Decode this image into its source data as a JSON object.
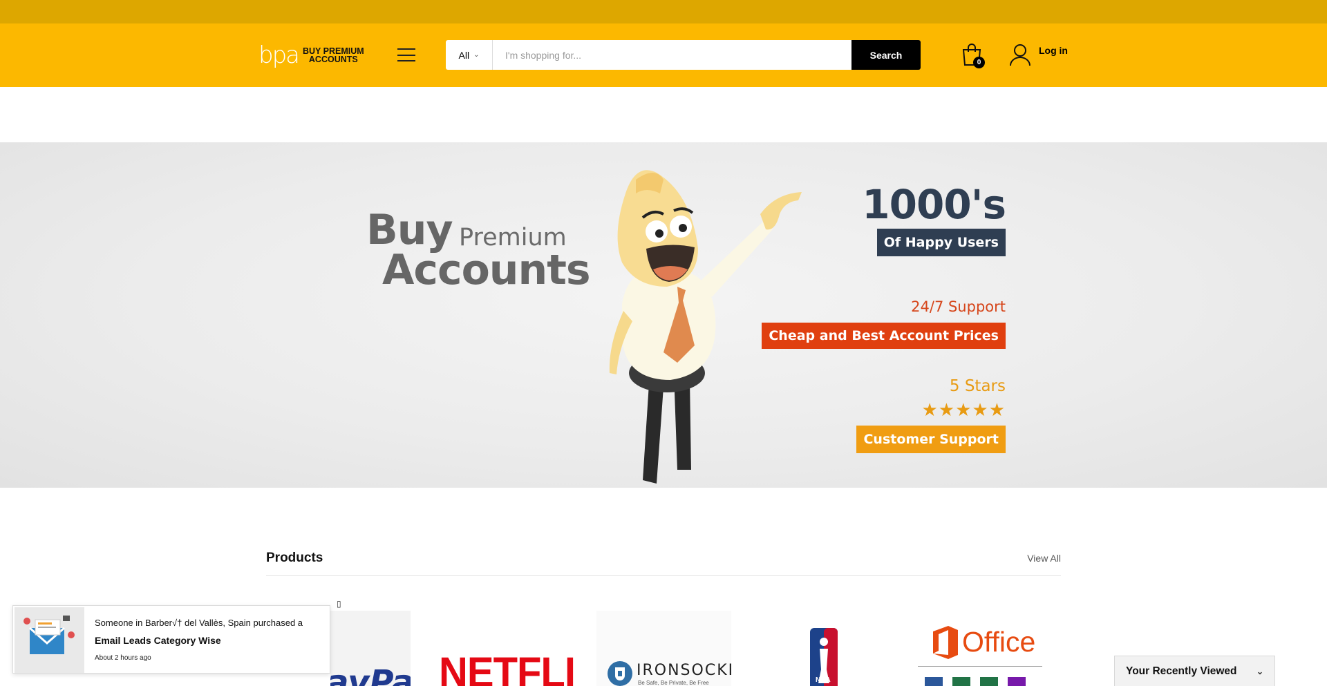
{
  "header": {
    "logo_mark": "bpa",
    "logo_text_line1": "BUY PREMIUM",
    "logo_text_line2": "ACCOUNTS",
    "search_category": "All",
    "search_placeholder": "I'm shopping for...",
    "search_button": "Search",
    "cart_count": "0",
    "login_label": "Log in"
  },
  "hero": {
    "buy": "Buy",
    "premium": "Premium",
    "accounts": "Accounts",
    "stat_big": "1000's",
    "happy_users": "Of Happy Users",
    "support_sub": "24/7 Support",
    "cheap_prices": "Cheap and Best Account Prices",
    "stars_sub": "5 Stars",
    "stars": "★★★★★",
    "customer_support": "Customer Support"
  },
  "products": {
    "title": "Products",
    "view_all": "View All",
    "small_box": "▯",
    "items": [
      {
        "label": "PayPal"
      },
      {
        "label": "NETFLIX"
      },
      {
        "label": "IRONSOCKET",
        "tagline": "Be Safe, Be Private, Be Free"
      },
      {
        "label": "NBA"
      },
      {
        "label": "Office"
      }
    ]
  },
  "notification": {
    "line1": "Someone in Barber√† del Vallès, Spain purchased a",
    "product": "Email Leads Category Wise",
    "time": "About 2 hours ago"
  },
  "recently_viewed": {
    "label": "Your Recently Viewed"
  },
  "colors": {
    "topbar": "#dda700",
    "header": "#fcb800",
    "navy": "#2f3e52",
    "red": "#e03f0f",
    "orange": "#f09d12"
  }
}
